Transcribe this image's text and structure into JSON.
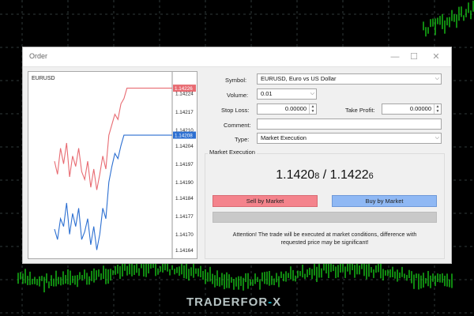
{
  "dialog": {
    "title": "Order"
  },
  "chart": {
    "symbol": "EURUSD",
    "price_labels": [
      "1.14226",
      "1.14224",
      "1.14217",
      "1.14210",
      "1.14208",
      "1.14204",
      "1.14197",
      "1.14190",
      "1.14184",
      "1.14177",
      "1.14170",
      "1.14164"
    ],
    "ask_label": "1.14226",
    "bid_label": "1.14208"
  },
  "chart_data": {
    "type": "line",
    "title": "EURUSD",
    "ylim": [
      1.14162,
      1.14228
    ],
    "series": [
      {
        "color": "#e86b72",
        "values": [
          1.14198,
          1.14193,
          1.14203,
          1.14197,
          1.14205,
          1.14192,
          1.142,
          1.14196,
          1.14203,
          1.14194,
          1.14191,
          1.14198,
          1.14188,
          1.14195,
          1.14187,
          1.14193,
          1.142,
          1.14195,
          1.14208,
          1.14212,
          1.14216,
          1.14214,
          1.1422,
          1.14222,
          1.14226,
          1.14226,
          1.14226,
          1.14226,
          1.14226
        ]
      },
      {
        "color": "#2c6fd1",
        "values": [
          1.14172,
          1.14168,
          1.14176,
          1.14173,
          1.14182,
          1.1417,
          1.14178,
          1.14173,
          1.1418,
          1.14168,
          1.14171,
          1.14176,
          1.14166,
          1.14173,
          1.14164,
          1.1417,
          1.1418,
          1.14176,
          1.1419,
          1.14196,
          1.14201,
          1.14199,
          1.14204,
          1.14208,
          1.14208,
          1.14208,
          1.14208,
          1.14208,
          1.14208
        ]
      }
    ]
  },
  "form": {
    "symbol_label": "Symbol:",
    "symbol_value": "EURUSD, Euro vs US Dollar",
    "volume_label": "Volume:",
    "volume_value": "0.01",
    "stoploss_label": "Stop Loss:",
    "stoploss_value": "0.00000",
    "takeprofit_label": "Take Profit:",
    "takeprofit_value": "0.00000",
    "comment_label": "Comment:",
    "comment_value": "",
    "type_label": "Type:",
    "type_value": "Market Execution"
  },
  "execution": {
    "group_label": "Market Execution",
    "bid_main": "1.1420",
    "bid_small": "8",
    "separator": "/",
    "ask_main": "1.1422",
    "ask_small": "6",
    "sell_label": "Sell by Market",
    "buy_label": "Buy by Market",
    "attention_line1": "Attention! The trade will be executed at market conditions, difference with",
    "attention_line2": "requested price may be significant!"
  },
  "watermark": {
    "part1": "TRADERFOR",
    "dash": "-",
    "x": "X"
  }
}
